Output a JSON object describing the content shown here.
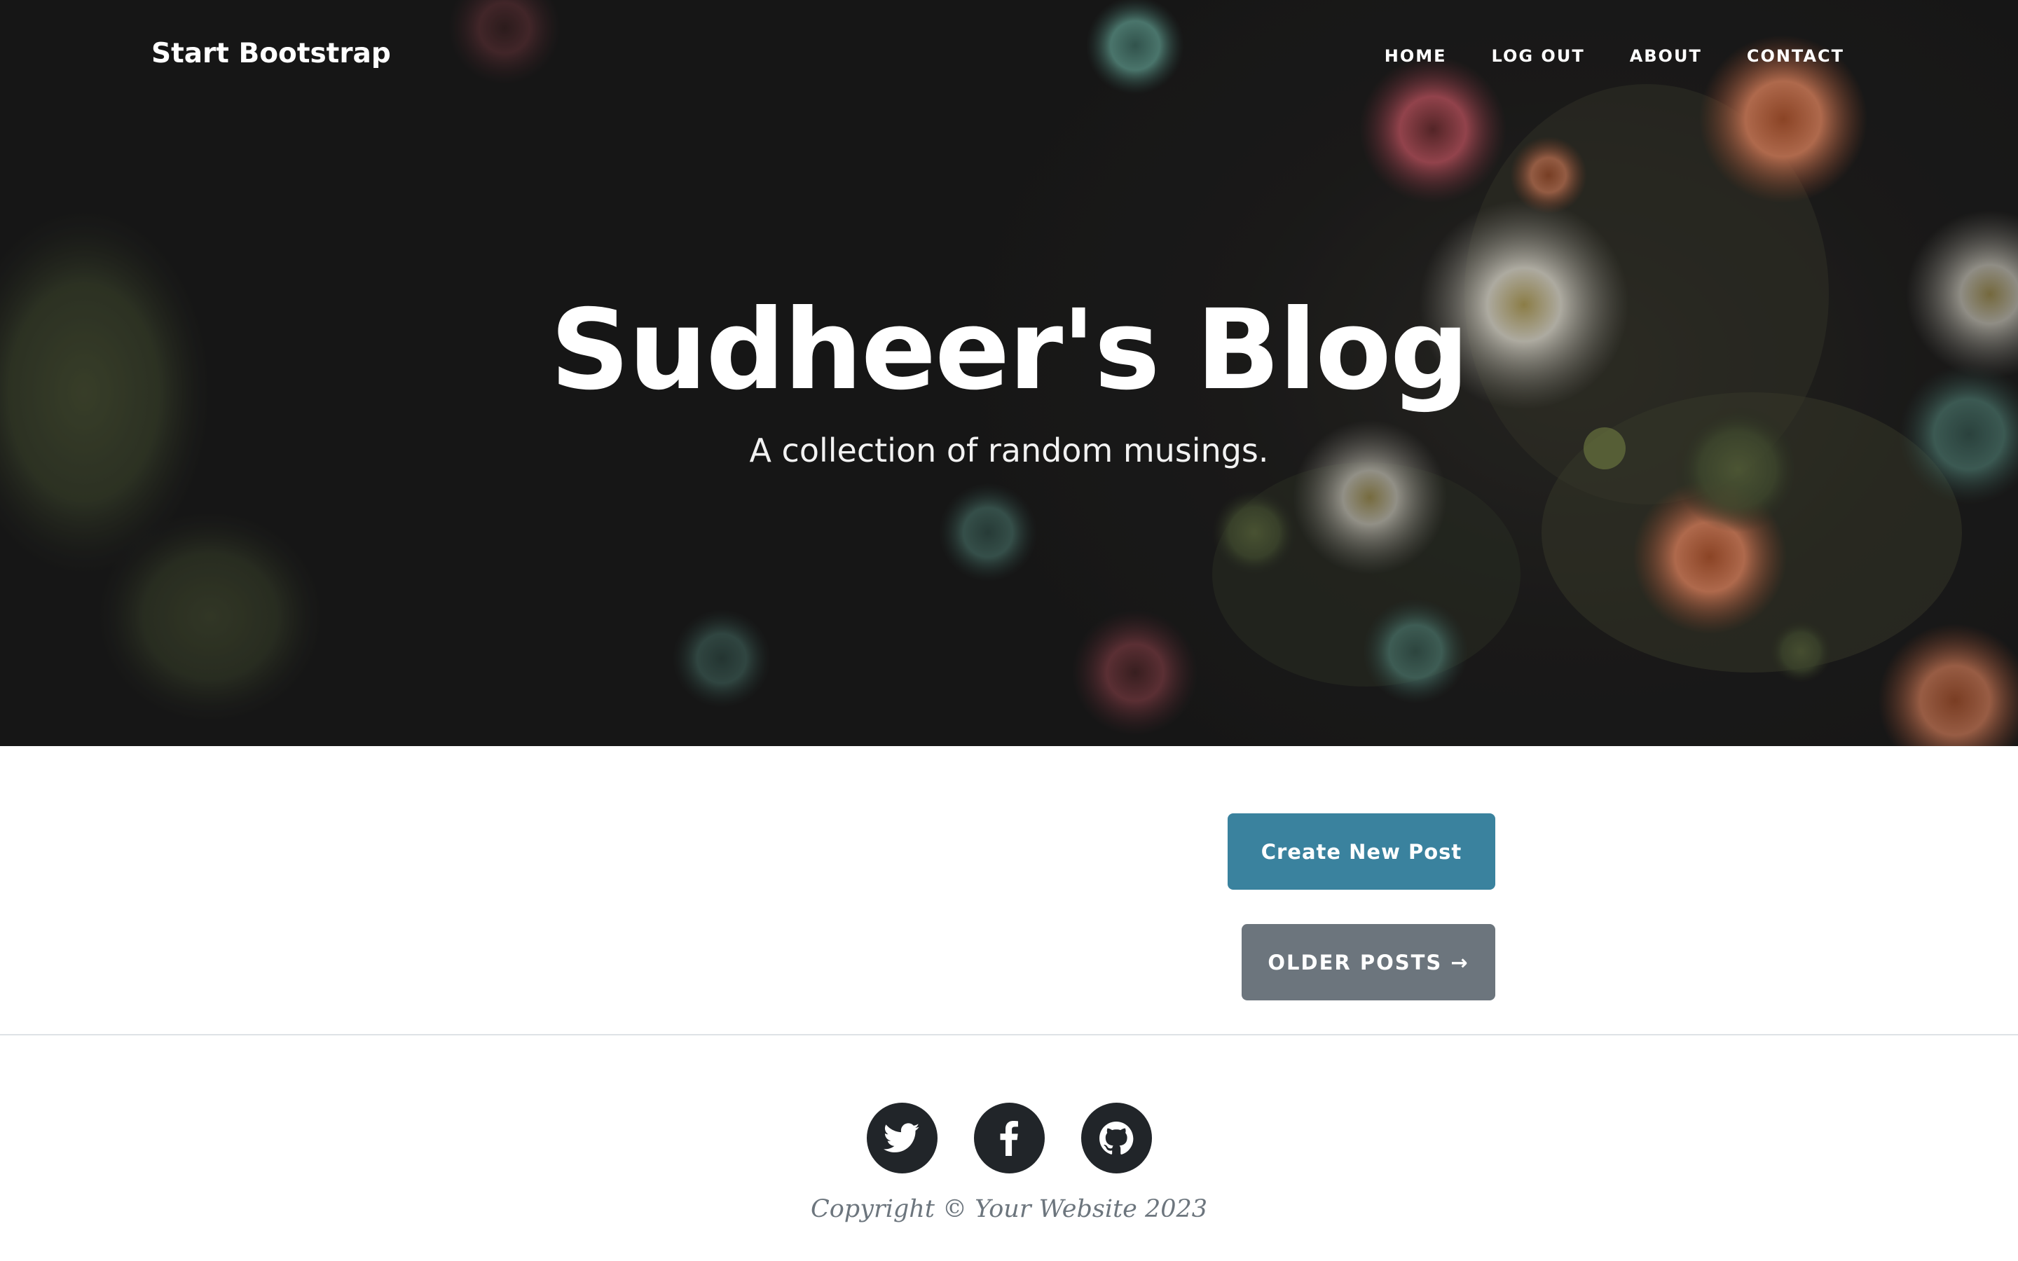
{
  "navbar": {
    "brand": "Start Bootstrap",
    "links": [
      {
        "label": "Home"
      },
      {
        "label": "Log Out"
      },
      {
        "label": "About"
      },
      {
        "label": "Contact"
      }
    ]
  },
  "hero": {
    "title": "Sudheer's Blog",
    "subtitle": "A collection of random musings."
  },
  "actions": {
    "create_post": "Create New Post",
    "older_posts": "Older Posts",
    "older_posts_arrow": "→"
  },
  "footer": {
    "social": [
      {
        "icon": "twitter-icon"
      },
      {
        "icon": "facebook-icon"
      },
      {
        "icon": "github-icon"
      }
    ],
    "copyright": "Copyright © Your Website 2023"
  },
  "colors": {
    "primary_button": "#3a829e",
    "secondary_button": "#6c757d",
    "social_circle": "#212529",
    "muted_text": "#6c757d"
  }
}
